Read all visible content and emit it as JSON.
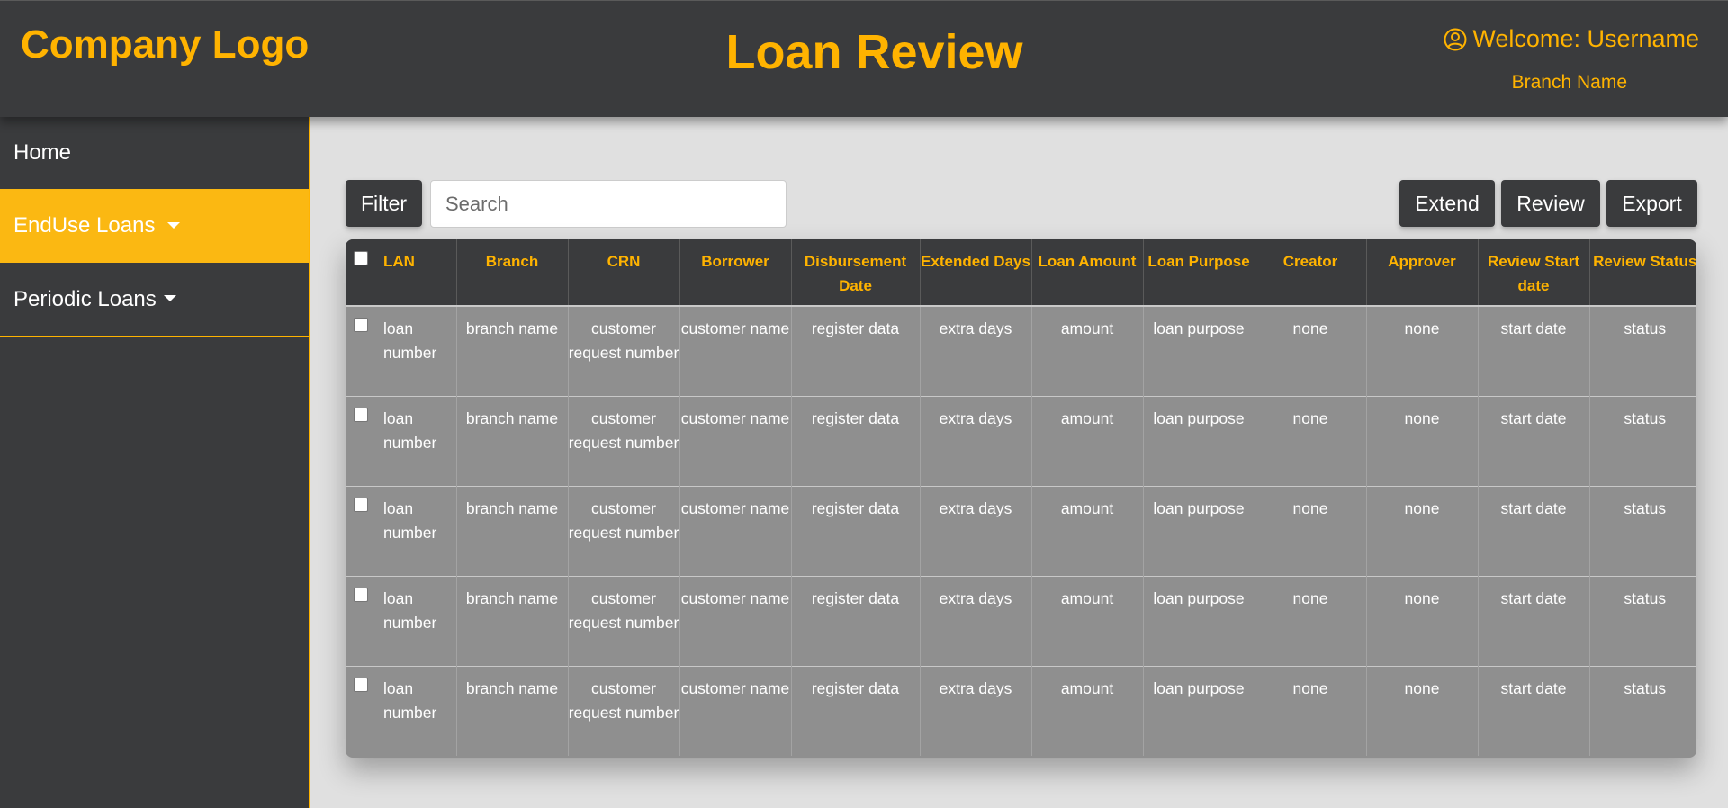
{
  "header": {
    "logo": "Company Logo",
    "title": "Loan Review",
    "welcome": "Welcome: Username",
    "branch": "Branch Name"
  },
  "sidebar": {
    "items": [
      {
        "label": "Home"
      },
      {
        "label": "EndUse Loans"
      },
      {
        "label": "Periodic Loans"
      }
    ]
  },
  "toolbar": {
    "filter_label": "Filter",
    "search_placeholder": "Search",
    "extend_label": "Extend",
    "review_label": "Review",
    "export_label": "Export"
  },
  "table": {
    "columns": [
      "LAN",
      "Branch",
      "CRN",
      "Borrower",
      "Disbursement Date",
      "Extended Days",
      "Loan Amount",
      "Loan Purpose",
      "Creator",
      "Approver",
      "Review Start date",
      "Review Status"
    ],
    "rows": [
      [
        "loan number",
        "branch name",
        "customer request number",
        "customer name",
        "register data",
        "extra days",
        "amount",
        "loan purpose",
        "none",
        "none",
        "start date",
        "status"
      ],
      [
        "loan number",
        "branch name",
        "customer request number",
        "customer name",
        "register data",
        "extra days",
        "amount",
        "loan purpose",
        "none",
        "none",
        "start date",
        "status"
      ],
      [
        "loan number",
        "branch name",
        "customer request number",
        "customer name",
        "register data",
        "extra days",
        "amount",
        "loan purpose",
        "none",
        "none",
        "start date",
        "status"
      ],
      [
        "loan number",
        "branch name",
        "customer request number",
        "customer name",
        "register data",
        "extra days",
        "amount",
        "loan purpose",
        "none",
        "none",
        "start date",
        "status"
      ],
      [
        "loan number",
        "branch name",
        "customer request number",
        "customer name",
        "register data",
        "extra days",
        "amount",
        "loan purpose",
        "none",
        "none",
        "start date",
        "status"
      ]
    ]
  },
  "colors": {
    "accent": "#ffb300",
    "dark": "#3a3b3d",
    "table_body": "#8f8f8f"
  },
  "icons": {
    "user": "user-circle-icon",
    "caret": "caret-down-icon"
  }
}
